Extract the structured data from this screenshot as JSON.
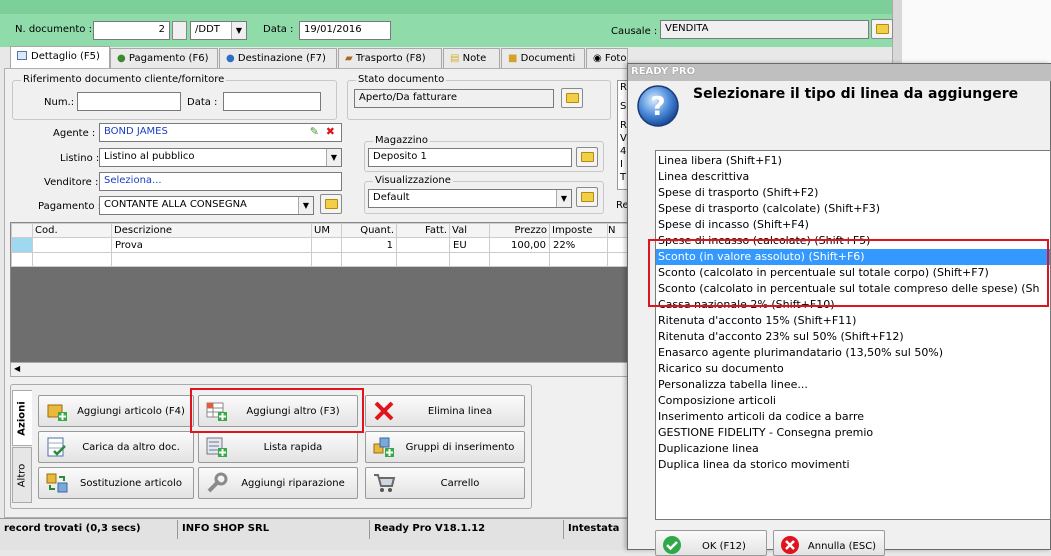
{
  "header": {
    "ndoc_label": "N. documento :",
    "ndoc_value": "2",
    "doc_type": "/DDT",
    "date_label": "Data :",
    "date_value": "19/01/2016",
    "causale_label": "Causale :",
    "causale_value": "VENDITA"
  },
  "tabs": [
    {
      "label": "Dettaglio (F5)"
    },
    {
      "label": "Pagamento (F6)"
    },
    {
      "label": "Destinazione (F7)"
    },
    {
      "label": "Trasporto (F8)"
    },
    {
      "label": "Note"
    },
    {
      "label": "Documenti"
    },
    {
      "label": "Foto"
    }
  ],
  "rif": {
    "title": "Riferimento documento cliente/fornitore",
    "num_label": "Num.:",
    "num_value": "",
    "data_label": "Data :",
    "data_value": ""
  },
  "stato": {
    "title": "Stato documento",
    "value": "Aperto/Da fatturare"
  },
  "form": {
    "agente_label": "Agente :",
    "agente_value": "BOND JAMES",
    "listino_label": "Listino :",
    "listino_value": "Listino al pubblico",
    "venditore_label": "Venditore :",
    "venditore_value": "Seleziona...",
    "pagamento_label": "Pagamento :",
    "pagamento_value": "CONTANTE ALLA CONSEGNA"
  },
  "magazzino": {
    "title": "Magazzino",
    "value": "Deposito 1"
  },
  "visualizzazione": {
    "title": "Visualizzazione",
    "value": "Default"
  },
  "side_fragment": {
    "r1": "R",
    "r2": "S",
    "r3": "R",
    "r4": "V",
    "r5": "4",
    "r6": "I",
    "r7": "T",
    "r8": "Re"
  },
  "grid": {
    "columns": [
      "Cod.",
      "Descrizione",
      "UM",
      "Quant.",
      "Fatt.",
      "Val",
      "Prezzo",
      "Imposte",
      "N"
    ],
    "rows": [
      [
        "",
        "Prova",
        "",
        "1",
        "",
        "EU",
        "100,00",
        "22%",
        ""
      ]
    ]
  },
  "actions": {
    "side_tab_azioni": "Azioni",
    "side_tab_altro": "Altro",
    "buttons": [
      "Aggiungi articolo (F4)",
      "Aggiungi altro (F3)",
      "Elimina linea",
      "Carica da altro doc.",
      "Lista rapida",
      "Gruppi di inserimento",
      "Sostituzione articolo",
      "Aggiungi riparazione",
      "Carrello"
    ]
  },
  "status_bar": {
    "records": "record trovati (0,3 secs)",
    "company": "INFO SHOP SRL",
    "version": "Ready Pro V18.1.12",
    "intestatario": "Intestata"
  },
  "dialog": {
    "title": "READY PRO",
    "question": "Selezionare il tipo di linea da aggiungere",
    "items": [
      "Linea libera (Shift+F1)",
      "Linea descrittiva",
      "Spese di trasporto (Shift+F2)",
      "Spese di trasporto (calcolate) (Shift+F3)",
      "Spese di incasso (Shift+F4)",
      "Spese di incasso (calcolate) (Shift+F5)",
      "Sconto (in valore assoluto) (Shift+F6)",
      "Sconto (calcolato in percentuale sul totale corpo) (Shift+F7)",
      "Sconto (calcolato in percentuale sul totale compreso delle spese) (Sh",
      "Cassa nazionale 2% (Shift+F10)",
      "Ritenuta d'acconto 15% (Shift+F11)",
      "Ritenuta d'acconto 23% sul 50% (Shift+F12)",
      "Enasarco agente plurimandatario (13,50% sul 50%)",
      "Ricarico su documento",
      "Personalizza tabella linee...",
      "Composizione articoli",
      "Inserimento articoli da codice a barre",
      "GESTIONE FIDELITY - Consegna premio",
      "Duplicazione linea",
      "Duplica linea da storico movimenti"
    ],
    "selected_index": 6,
    "ok_label": "OK (F12)",
    "cancel_label": "Annulla (ESC)"
  },
  "colors": {
    "header_bg": "#8fdcaa",
    "selection": "#3399ff",
    "highlight": "#e0141e"
  }
}
